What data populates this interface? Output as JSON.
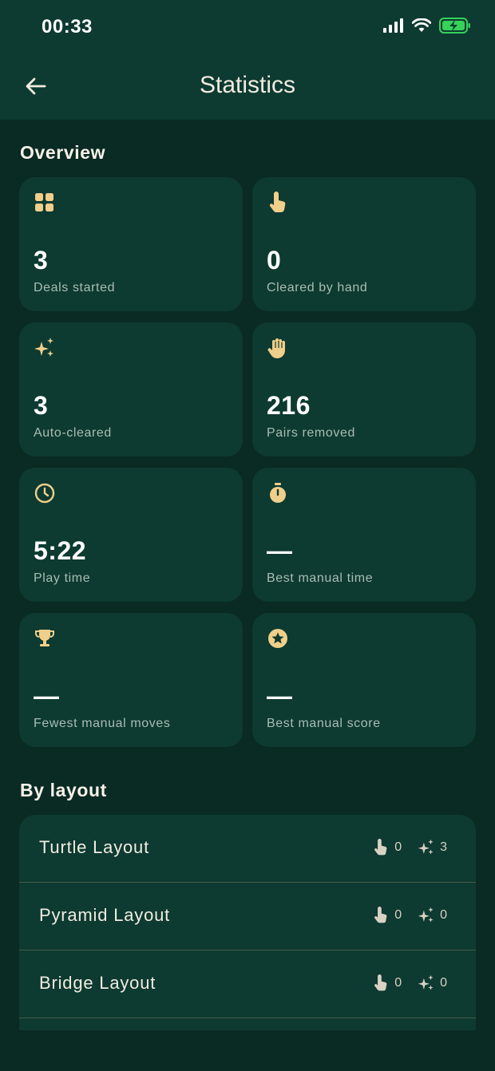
{
  "status_bar": {
    "time": "00:33"
  },
  "header": {
    "title": "Statistics"
  },
  "sections": {
    "overview": "Overview",
    "by_layout": "By layout"
  },
  "cards": [
    {
      "icon": "grid-icon",
      "value": "3",
      "label": "Deals started"
    },
    {
      "icon": "tap-finger-icon",
      "value": "0",
      "label": "Cleared by hand"
    },
    {
      "icon": "sparkles-icon",
      "value": "3",
      "label": "Auto-cleared"
    },
    {
      "icon": "hand-icon",
      "value": "216",
      "label": "Pairs removed"
    },
    {
      "icon": "clock-icon",
      "value": "5:22",
      "label": "Play time"
    },
    {
      "icon": "stopwatch-icon",
      "value": "—",
      "label": "Best manual time"
    },
    {
      "icon": "trophy-icon",
      "value": "—",
      "label": "Fewest manual moves"
    },
    {
      "icon": "star-circle-icon",
      "value": "—",
      "label": "Best manual score"
    }
  ],
  "layouts": [
    {
      "name": "Turtle Layout",
      "manual": "0",
      "auto": "3"
    },
    {
      "name": "Pyramid Layout",
      "manual": "0",
      "auto": "0"
    },
    {
      "name": "Bridge Layout",
      "manual": "0",
      "auto": "0"
    }
  ],
  "colors": {
    "accent": "#f0cf8a",
    "card": "#0d3a31",
    "background": "#0a2a24"
  }
}
